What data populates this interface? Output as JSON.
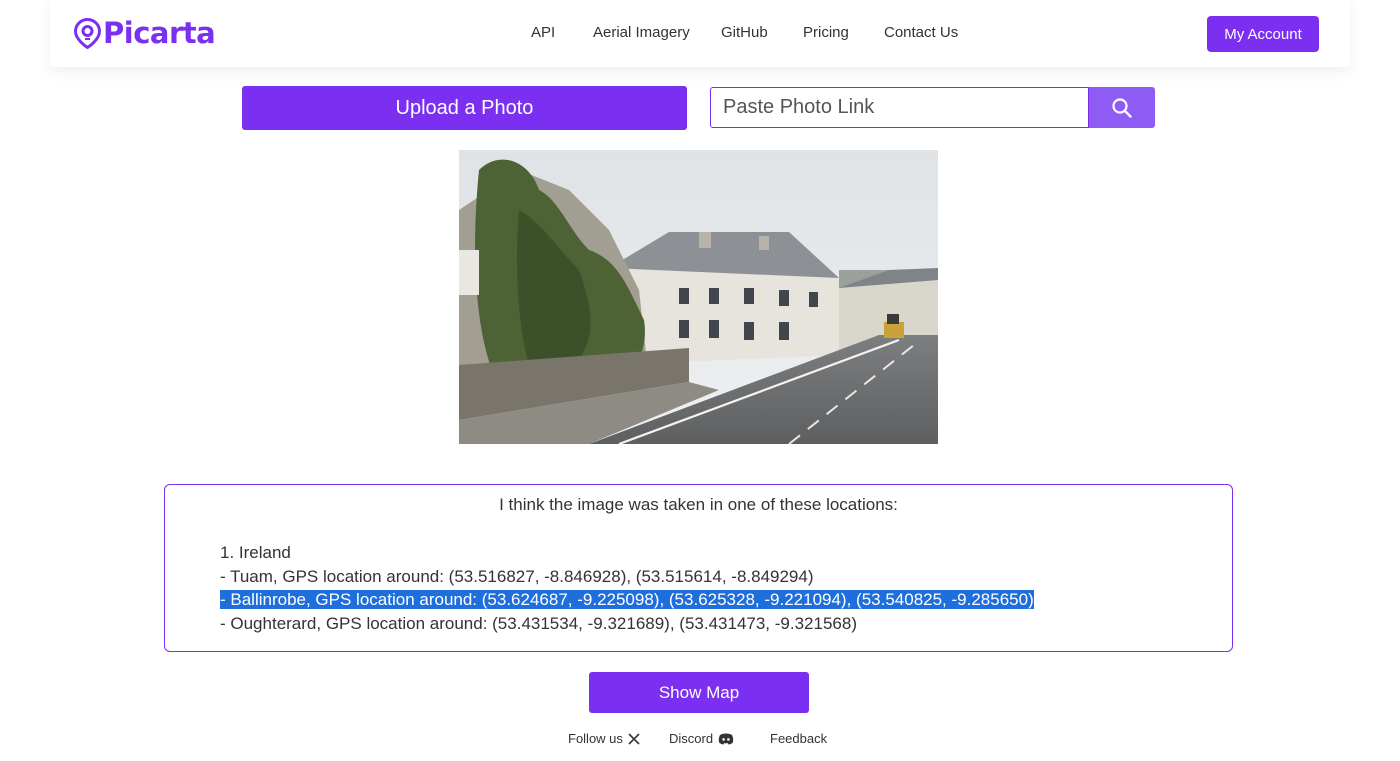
{
  "brand": {
    "name": "Picarta",
    "accent": "#7b2ff0"
  },
  "nav": {
    "links": [
      "API",
      "Aerial Imagery",
      "GitHub",
      "Pricing",
      "Contact Us"
    ],
    "account_label": "My Account"
  },
  "upload": {
    "button_label": "Upload a Photo",
    "link_placeholder": "Paste Photo Link",
    "search_icon": "magnifier-icon"
  },
  "photo": {
    "description_icon": "street-photo"
  },
  "result": {
    "intro": "I think the image was taken in one of these locations:",
    "lines": [
      "1. Ireland",
      "- Tuam, GPS location around: (53.516827, -8.846928), (53.515614, -8.849294)",
      "- Ballinrobe, GPS location around: (53.624687, -9.225098), (53.625328, -9.221094), (53.540825, -9.285650)",
      "- Oughterard, GPS location around: (53.431534, -9.321689), (53.431473, -9.321568)"
    ],
    "selected_line_index": 2
  },
  "map_button_label": "Show Map",
  "footer": {
    "follow_label": "Follow us",
    "discord_label": "Discord",
    "feedback_label": "Feedback"
  }
}
